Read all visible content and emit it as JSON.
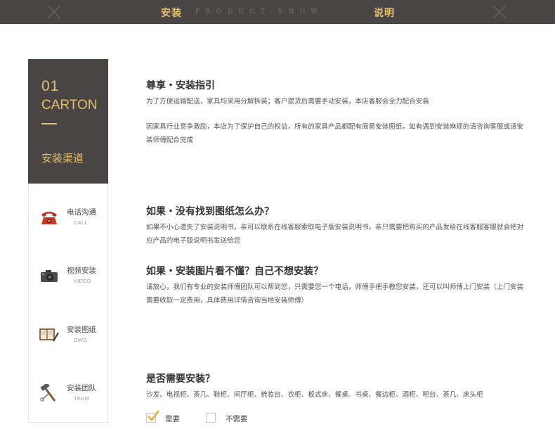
{
  "header": {
    "title_left": "安装",
    "subtitle": "PRODUCT-SHOW",
    "title_right": "说明",
    "accent_color": "#e3c06f",
    "bar_color": "#4a4545"
  },
  "sidebar": {
    "number": "01",
    "carton": "CARTON",
    "channel_title": "安装渠道",
    "items": [
      {
        "label": "电话沟通",
        "en": "CALL",
        "icon": "telephone-icon"
      },
      {
        "label": "视频安装",
        "en": "VIDEO",
        "icon": "camera-icon"
      },
      {
        "label": "安装图纸",
        "en": "DWG",
        "icon": "notebook-icon"
      },
      {
        "label": "安装团队",
        "en": "TEAM",
        "icon": "tools-icon"
      }
    ]
  },
  "sections": {
    "guide": {
      "title": "尊享・安装指引",
      "p1": "为了方便运输配送，家具均采用分解拆装；客户提货后需要手动安装，本店客服会全力配合安装",
      "p2": "因家具行业竞争激励，本店为了保护自己的权益，所有的家具产品都配有简易安装图纸，如有遇到安装麻烦的请咨询客服或请安装师傅配合完成"
    },
    "no_drawing": {
      "title": "如果・没有找到图纸怎么办？",
      "p": "如果不小心遗失了安装说明书，亲可以联系在线客服索取电子版安装说明书。亲只需要把购买的产品发给在线客服客服就会把对应产品的电子版说明书发送给您"
    },
    "not_understand": {
      "title": "如果・安装图片看不懂？自己不想安装？",
      "p": "请放心，我们有专业的安装师傅团队可以帮到您，只需要您一个电话，师傅手把手教您安装，还可以叫师傅上门安装（上门安装需要收取一定费用，具体费用详情咨询当地安装师傅）"
    },
    "need_install": {
      "title": "是否需要安装？",
      "p": "沙发、电视柜、茶几、鞋柜、间厅柜、梳妆台、衣柜、板式床、餐桌、书桌、餐边柜、酒柜、吧台、茶几、床头柜"
    }
  },
  "options": [
    {
      "label": "需要",
      "checked": true
    },
    {
      "label": "不需要",
      "checked": false
    }
  ]
}
